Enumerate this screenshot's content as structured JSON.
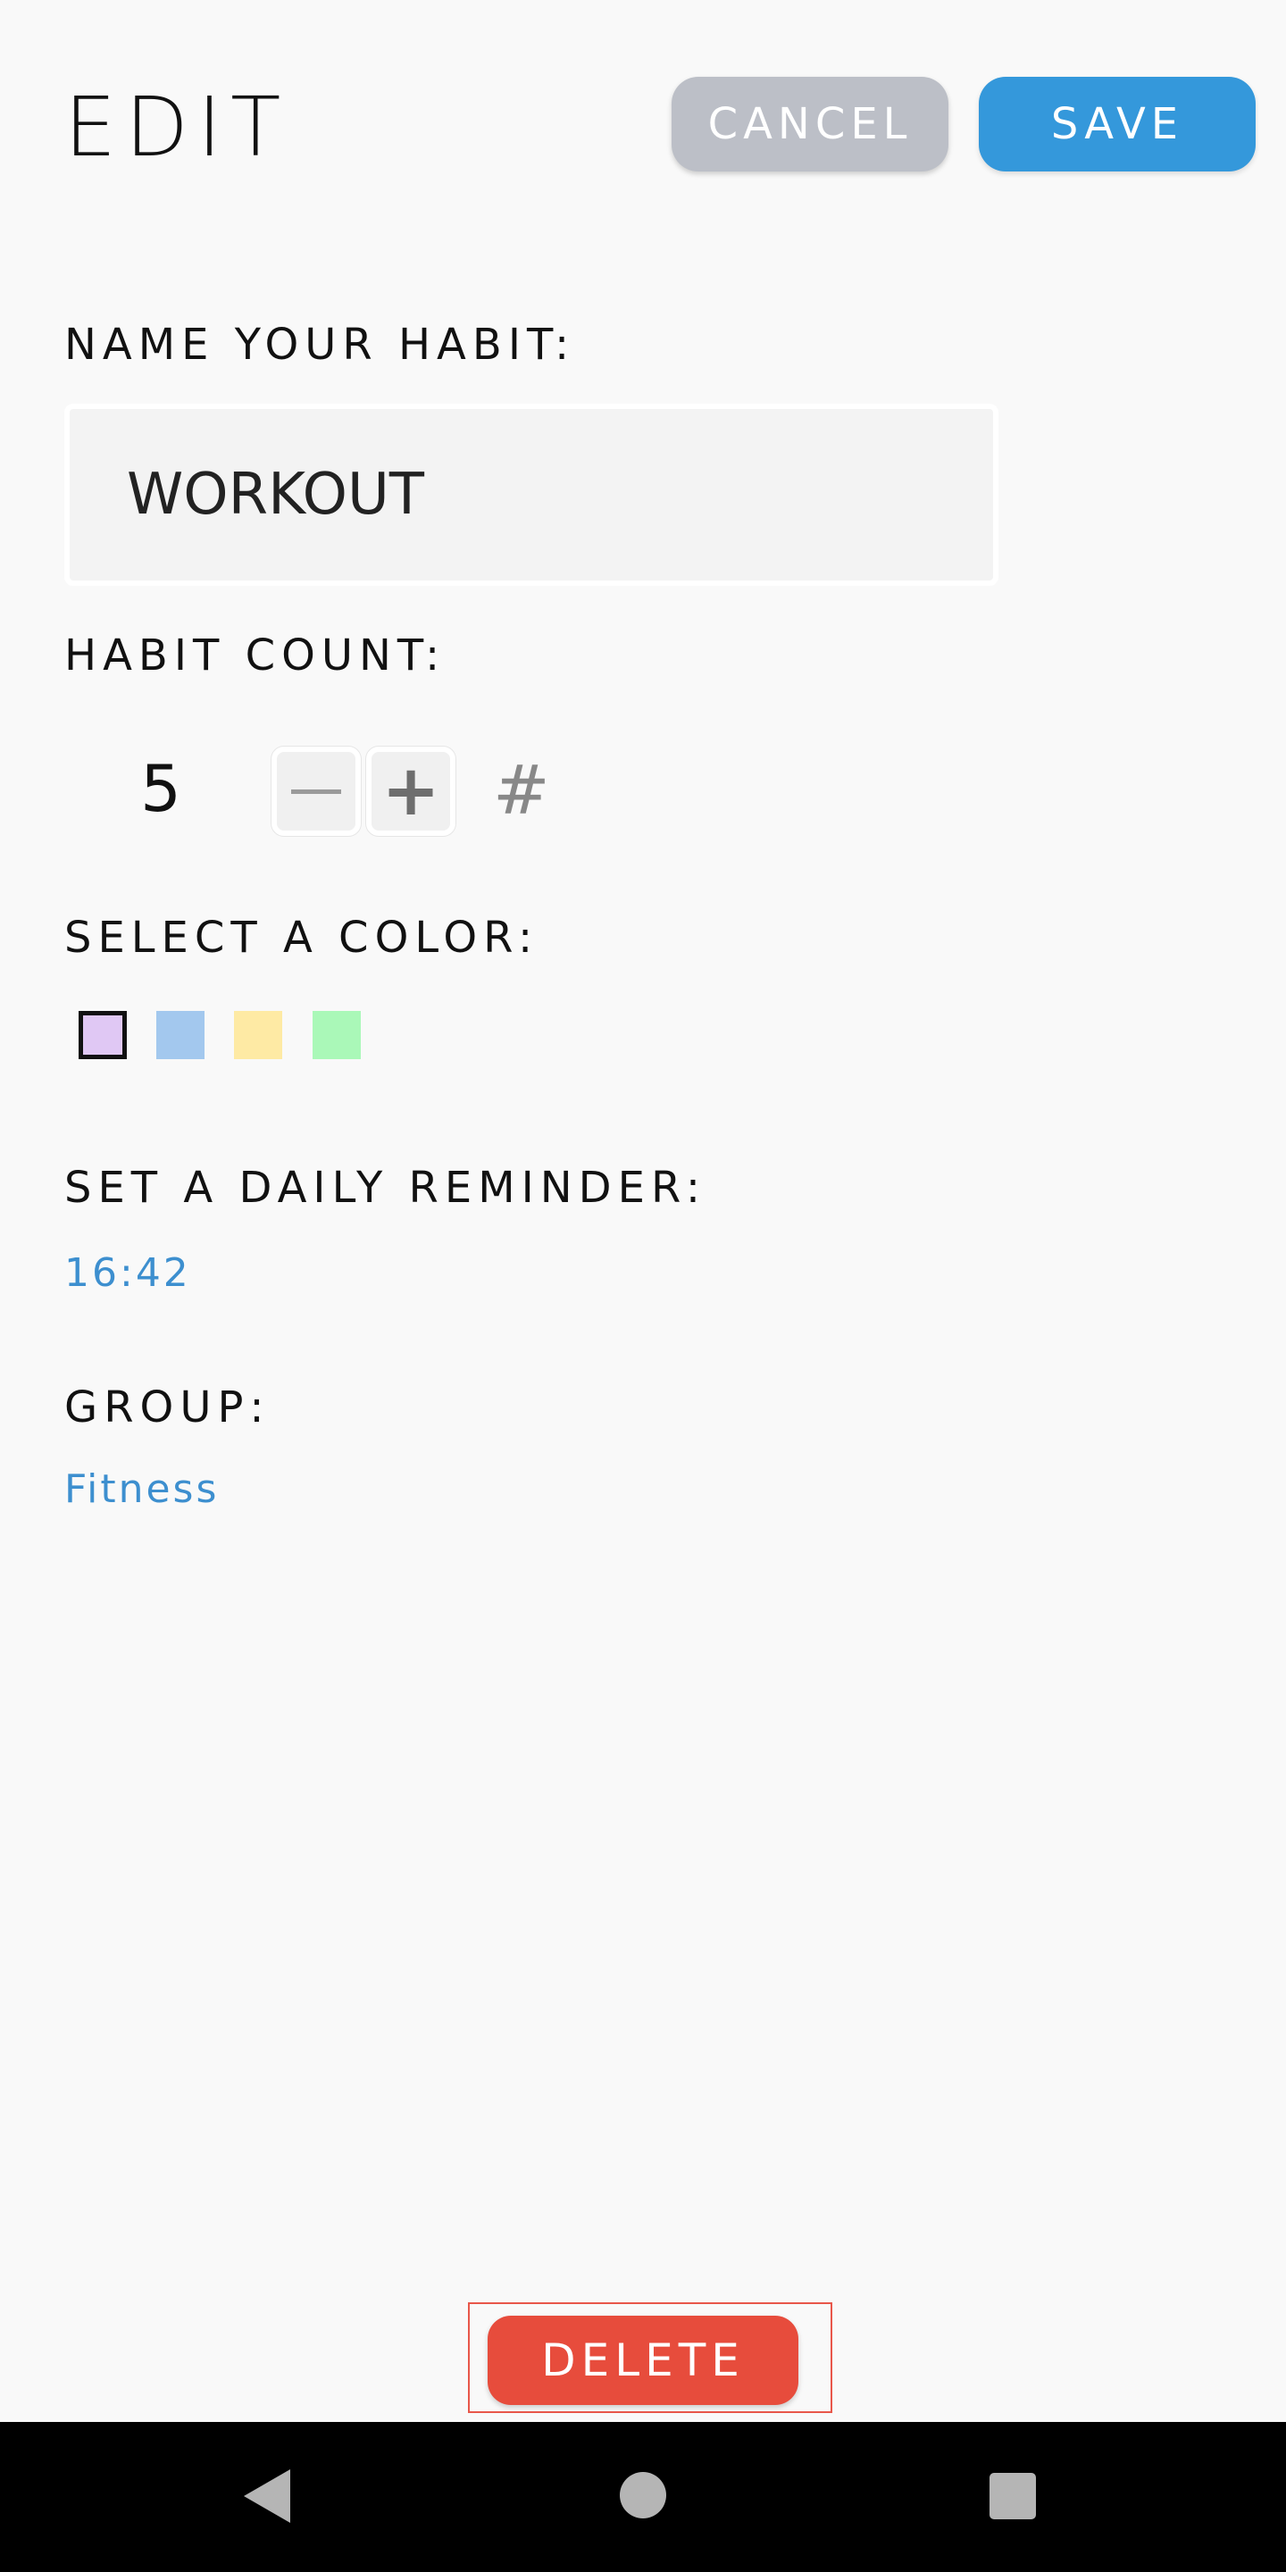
{
  "header": {
    "title": "EDIT",
    "cancel_label": "CANCEL",
    "save_label": "SAVE"
  },
  "name": {
    "label": "NAME YOUR HABIT:",
    "value": "WORKOUT"
  },
  "count": {
    "label": "HABIT COUNT:",
    "value": "5",
    "decrement_icon": "minus-icon",
    "increment_icon": "plus-icon",
    "hash_symbol": "#"
  },
  "color": {
    "label": "SELECT A COLOR:",
    "options": [
      {
        "color": "#e0c8f4",
        "selected": true
      },
      {
        "color": "#a3c8ee",
        "selected": false
      },
      {
        "color": "#feeaa4",
        "selected": false
      },
      {
        "color": "#aaf8b8",
        "selected": false
      }
    ]
  },
  "reminder": {
    "label": "SET A DAILY REMINDER:",
    "value": "16:42"
  },
  "group": {
    "label": "GROUP:",
    "value": "Fitness"
  },
  "footer": {
    "delete_label": "DELETE"
  },
  "navbar": {
    "back_icon": "back-triangle-icon",
    "home_icon": "home-circle-icon",
    "recents_icon": "recents-square-icon"
  },
  "theme": {
    "accent": "#3498db",
    "cancel": "#bcbfc7",
    "danger": "#e74c3c",
    "link": "#3d8fcf"
  }
}
